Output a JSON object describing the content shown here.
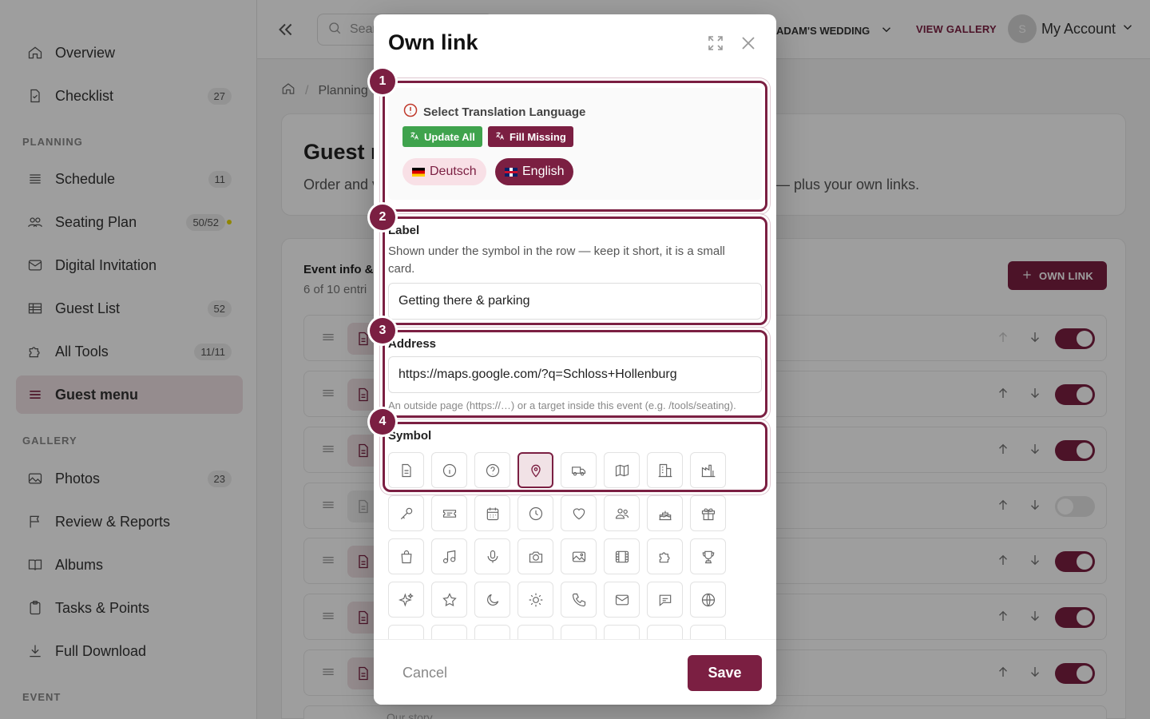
{
  "sidebar": {
    "items": [
      {
        "label": "Overview",
        "icon": "home-icon"
      },
      {
        "label": "Checklist",
        "icon": "document-icon",
        "badge": "27"
      },
      {
        "label": "Schedule",
        "icon": "list-icon",
        "badge": "11"
      },
      {
        "label": "Seating Plan",
        "icon": "people-icon",
        "badge": "50/52"
      },
      {
        "label": "Digital Invitation",
        "icon": "mail-icon"
      },
      {
        "label": "Guest List",
        "icon": "table-icon",
        "badge": "52"
      },
      {
        "label": "All Tools",
        "icon": "puzzle-icon",
        "badge": "11/11"
      },
      {
        "label": "Guest menu",
        "icon": "menu-icon"
      },
      {
        "label": "Photos",
        "icon": "image-icon",
        "badge": "23"
      },
      {
        "label": "Review & Reports",
        "icon": "flag-icon"
      },
      {
        "label": "Albums",
        "icon": "book-icon"
      },
      {
        "label": "Tasks & Points",
        "icon": "clipboard-icon"
      },
      {
        "label": "Full Download",
        "icon": "download-icon"
      }
    ],
    "sections": {
      "planning": "PLANNING",
      "gallery": "GALLERY",
      "event": "EVENT"
    },
    "active_color": "#f1e2e6"
  },
  "topbar": {
    "search_placeholder": "Sear",
    "event_name": "ADAM'S WEDDING",
    "view_gallery": "VIEW GALLERY",
    "avatar_initial": "S",
    "account_label": "My Account"
  },
  "main": {
    "breadcrumb": "Planning",
    "title": "Guest n",
    "description": "Order and v",
    "description_tail": "— plus your own links.",
    "list_title": "Event info &",
    "list_subtitle": "6 of 10 entri",
    "own_link_button": "OWN LINK",
    "last_row_label": "Our story",
    "rows": [
      {
        "enabled": true
      },
      {
        "enabled": true
      },
      {
        "enabled": true
      },
      {
        "enabled": false
      },
      {
        "enabled": true
      },
      {
        "enabled": true
      },
      {
        "enabled": true
      }
    ]
  },
  "modal": {
    "title": "Own link",
    "translation": {
      "heading": "Select Translation Language",
      "update_all": "Update All",
      "fill_missing": "Fill Missing",
      "languages": [
        {
          "name": "Deutsch",
          "selected": false
        },
        {
          "name": "English",
          "selected": true
        }
      ]
    },
    "label_field": {
      "label": "Label",
      "help": "Shown under the symbol in the row — keep it short, it is a small card.",
      "value": "Getting there & parking"
    },
    "address_field": {
      "label": "Address",
      "value": "https://maps.google.com/?q=Schloss+Hollenburg",
      "hint": "An outside page (https://…) or a target inside this event (e.g. /tools/seating)."
    },
    "symbol_field": {
      "label": "Symbol",
      "selected": "map-pin-icon",
      "icons": [
        "document-icon",
        "info-icon",
        "question-icon",
        "map-pin-icon",
        "truck-icon",
        "map-icon",
        "building-icon",
        "factory-icon",
        "key-icon",
        "ticket-icon",
        "calendar-icon",
        "clock-icon",
        "heart-icon",
        "people-icon",
        "cake-icon",
        "gift-icon",
        "bag-icon",
        "music-icon",
        "mic-icon",
        "camera-icon",
        "image-icon",
        "film-icon",
        "puzzle-icon",
        "trophy-icon",
        "sparkles-icon",
        "star-icon",
        "moon-icon",
        "sun-icon",
        "phone-icon",
        "mail-icon",
        "chat-icon",
        "globe-icon"
      ]
    },
    "cancel": "Cancel",
    "save": "Save"
  },
  "annotations": [
    "1",
    "2",
    "3",
    "4"
  ],
  "colors": {
    "brand": "#7b1f42",
    "success": "#3fa34d"
  }
}
